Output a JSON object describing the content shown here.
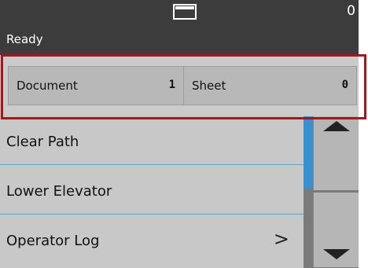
{
  "header": {
    "icon": "paper-tray-icon",
    "count": "0",
    "status": "Ready"
  },
  "counters": {
    "document": {
      "label": "Document",
      "value": "1"
    },
    "sheet": {
      "label": "Sheet",
      "value": "0"
    }
  },
  "menu": {
    "items": [
      {
        "label": "Clear Path"
      },
      {
        "label": "Lower Elevator"
      },
      {
        "label": "Operator Log",
        "chevron": ">"
      }
    ]
  },
  "colors": {
    "header_bg": "#3c3c3c",
    "highlight": "#a1181e",
    "accent": "#3a8fd0",
    "divider": "#5ba3d6"
  }
}
